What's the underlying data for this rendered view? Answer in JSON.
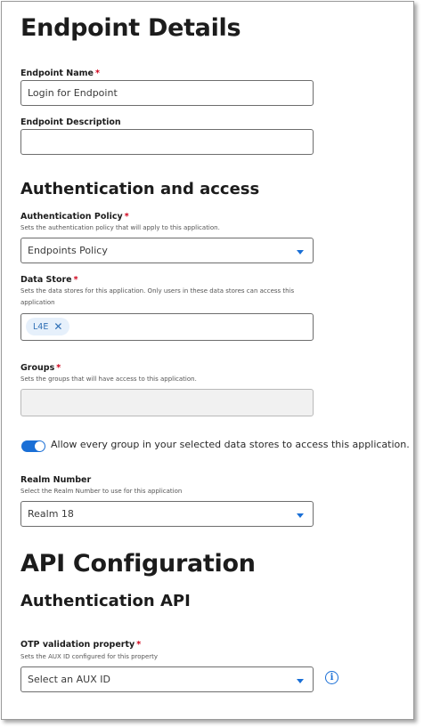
{
  "page": {
    "title": "Endpoint Details"
  },
  "endpoint_name": {
    "label": "Endpoint Name",
    "required": "*",
    "value": "Login for Endpoint"
  },
  "endpoint_description": {
    "label": "Endpoint Description",
    "value": ""
  },
  "auth_section": {
    "title": "Authentication and access"
  },
  "auth_policy": {
    "label": "Authentication Policy",
    "required": "*",
    "help": "Sets the authentication policy that will apply to this application.",
    "value": "Endpoints Policy"
  },
  "data_store": {
    "label": "Data Store",
    "required": "*",
    "help": "Sets the data stores for this application. Only users in these data stores can access this application",
    "chips": [
      {
        "label": "L4E",
        "remove": "✕"
      }
    ]
  },
  "groups": {
    "label": "Groups",
    "required": "*",
    "help": "Sets the groups that will have access to this application.",
    "value": ""
  },
  "allow_all_groups": {
    "label": "Allow every group in your selected data stores to access this application.",
    "enabled": true
  },
  "realm_number": {
    "label": "Realm Number",
    "help": "Select the Realm Number to use for this application",
    "value": "Realm 18"
  },
  "api_section": {
    "title": "API Configuration",
    "subtitle": "Authentication API"
  },
  "otp_property": {
    "label": "OTP validation property",
    "required": "*",
    "help": "Sets the AUX ID configured for this property",
    "placeholder": "Select an AUX ID",
    "info": "i"
  },
  "colors": {
    "accent": "#1a6fd6",
    "required": "#d0021b",
    "chip_bg": "#e6f0fb"
  }
}
